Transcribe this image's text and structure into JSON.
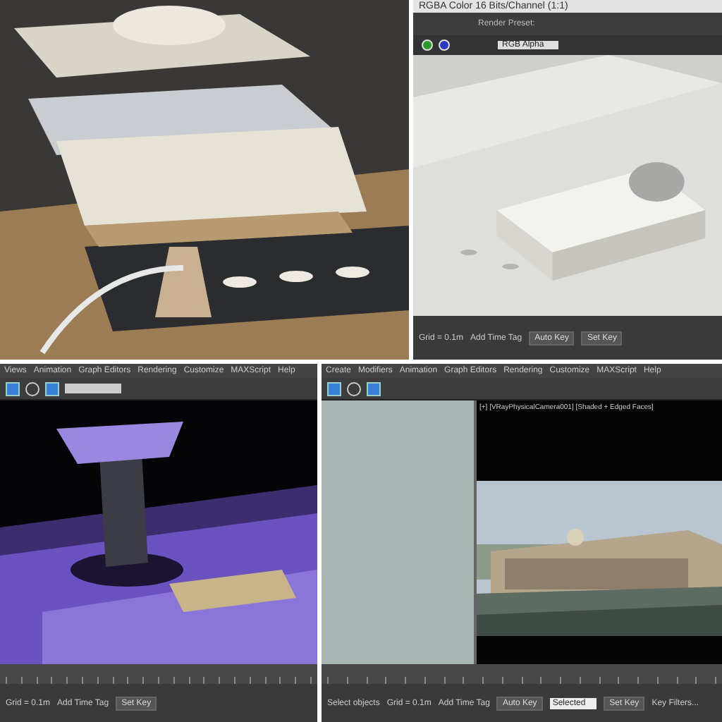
{
  "frame_window": {
    "title": "RGBA Color 16 Bits/Channel (1:1)",
    "preset_label": "Render Preset:",
    "channel": "RGB Alpha",
    "status": {
      "grid": "Grid = 0.1m",
      "time_tag": "Add Time Tag",
      "auto_key": "Auto Key",
      "set_key": "Set Key"
    }
  },
  "viewport_left": {
    "menu": [
      "Views",
      "Animation",
      "Graph Editors",
      "Rendering",
      "Customize",
      "MAXScript",
      "Help"
    ],
    "status": {
      "grid": "Grid = 0.1m",
      "time_tag": "Add Time Tag",
      "set_key": "Set Key"
    }
  },
  "viewport_right": {
    "menu": [
      "Create",
      "Modifiers",
      "Animation",
      "Graph Editors",
      "Rendering",
      "Customize",
      "MAXScript",
      "Help"
    ],
    "viewport_label": "[+] [VRayPhysicalCamera001] [Shaded + Edged Faces]",
    "prompt": "Select objects",
    "status": {
      "grid": "Grid = 0.1m",
      "time_tag": "Add Time Tag",
      "auto_key": "Auto Key",
      "selected": "Selected",
      "set_key": "Set Key",
      "key_filters": "Key Filters..."
    }
  }
}
